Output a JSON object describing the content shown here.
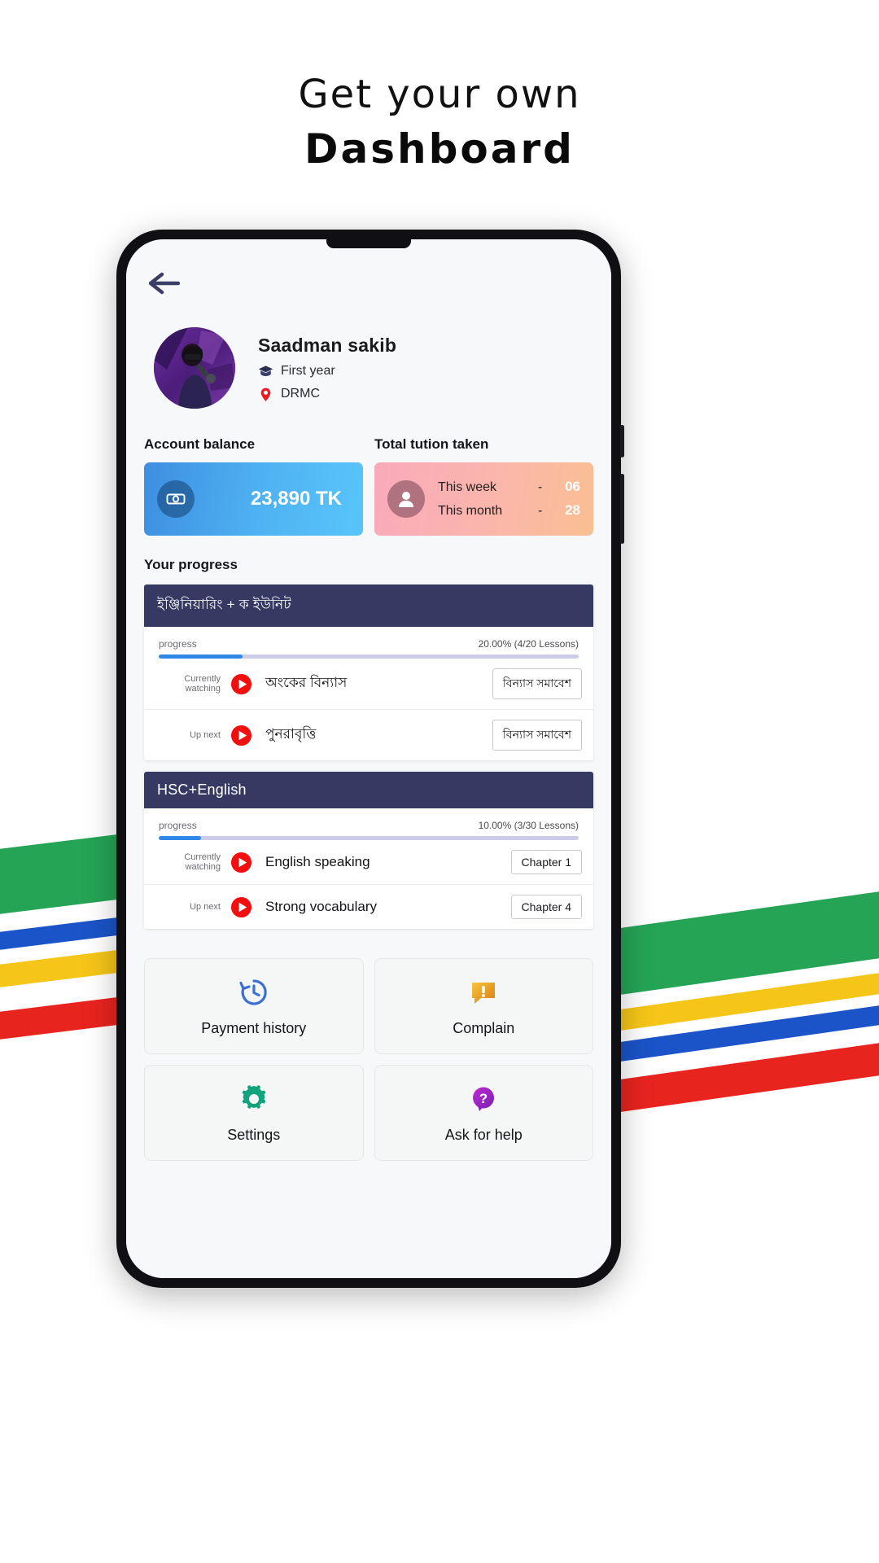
{
  "headline": {
    "line1": "Get your own",
    "line2": "Dashboard"
  },
  "app": {
    "back_icon": "arrow-left-icon",
    "profile": {
      "name": "Saadman sakib",
      "year": "First year",
      "year_icon": "graduation-cap-icon",
      "institution": "DRMC",
      "institution_icon": "location-pin-icon",
      "avatar_alt": "profile-photo"
    },
    "balance": {
      "label": "Account balance",
      "amount": "23,890 TK",
      "icon": "banknote-icon",
      "accent": "#4fb3f2"
    },
    "tuition": {
      "label": "Total tution taken",
      "icon": "person-icon",
      "accent": "#f9aabb",
      "rows": [
        {
          "label": "This week",
          "dash": "-",
          "value": "06"
        },
        {
          "label": "This month",
          "dash": "-",
          "value": "28"
        }
      ]
    },
    "progress_label": "Your progress",
    "courses": [
      {
        "title": "ইঞ্জিনিয়ারিং + ক ইউনিট",
        "is_bangla": true,
        "progress_label": "progress",
        "progress_value": "20.00% (4/20 Lessons)",
        "progress_percent": 20,
        "lessons": [
          {
            "state": "Currently watching",
            "name": "অংকের বিন্যাস",
            "chip": "বিন্যাস সমাবেশ",
            "icon": "play-icon",
            "is_bangla": true
          },
          {
            "state": "Up next",
            "name": "পুনরাবৃত্তি",
            "chip": "বিন্যাস সমাবেশ",
            "icon": "play-icon",
            "is_bangla": true
          }
        ]
      },
      {
        "title": "HSC+English",
        "is_bangla": false,
        "progress_label": "progress",
        "progress_value": "10.00% (3/30 Lessons)",
        "progress_percent": 10,
        "lessons": [
          {
            "state": "Currently watching",
            "name": "English speaking",
            "chip": "Chapter 1",
            "icon": "play-icon",
            "is_bangla": false
          },
          {
            "state": "Up next",
            "name": "Strong vocabulary",
            "chip": "Chapter 4",
            "icon": "play-icon",
            "is_bangla": false
          }
        ]
      }
    ],
    "tiles": [
      {
        "label": "Payment history",
        "icon": "history-clock-icon",
        "color": "#3b6fd4"
      },
      {
        "label": "Complain",
        "icon": "warning-chat-icon",
        "color": "#e8a317"
      },
      {
        "label": "Settings",
        "icon": "gear-icon",
        "color": "#12a37a"
      },
      {
        "label": "Ask for help",
        "icon": "question-chat-icon",
        "color": "#a128c8"
      }
    ]
  },
  "ribbon_colors": {
    "green": "#25a455",
    "yellow": "#f5c518",
    "blue": "#1b54c8",
    "red": "#e8241f"
  }
}
